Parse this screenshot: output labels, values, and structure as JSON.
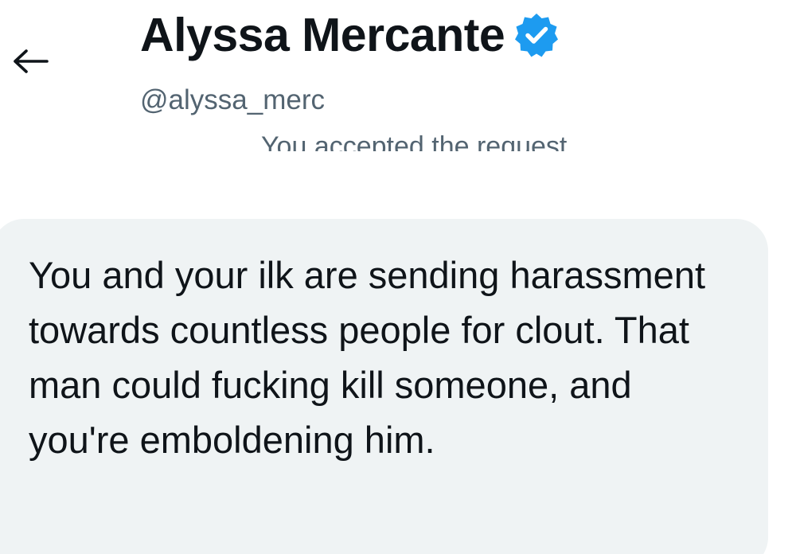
{
  "header": {
    "back_icon": "arrow-left-icon",
    "display_name": "Alyssa Mercante",
    "verified_icon": "verified-badge-icon",
    "verified_color": "#1d9bf0",
    "handle": "@alyssa_merc"
  },
  "conversation": {
    "system_note": "You accepted the request",
    "messages": [
      {
        "text": "You and your ilk are sending harassment towards countless people for clout. That man could fucking kill someone, and you're emboldening him."
      }
    ]
  }
}
